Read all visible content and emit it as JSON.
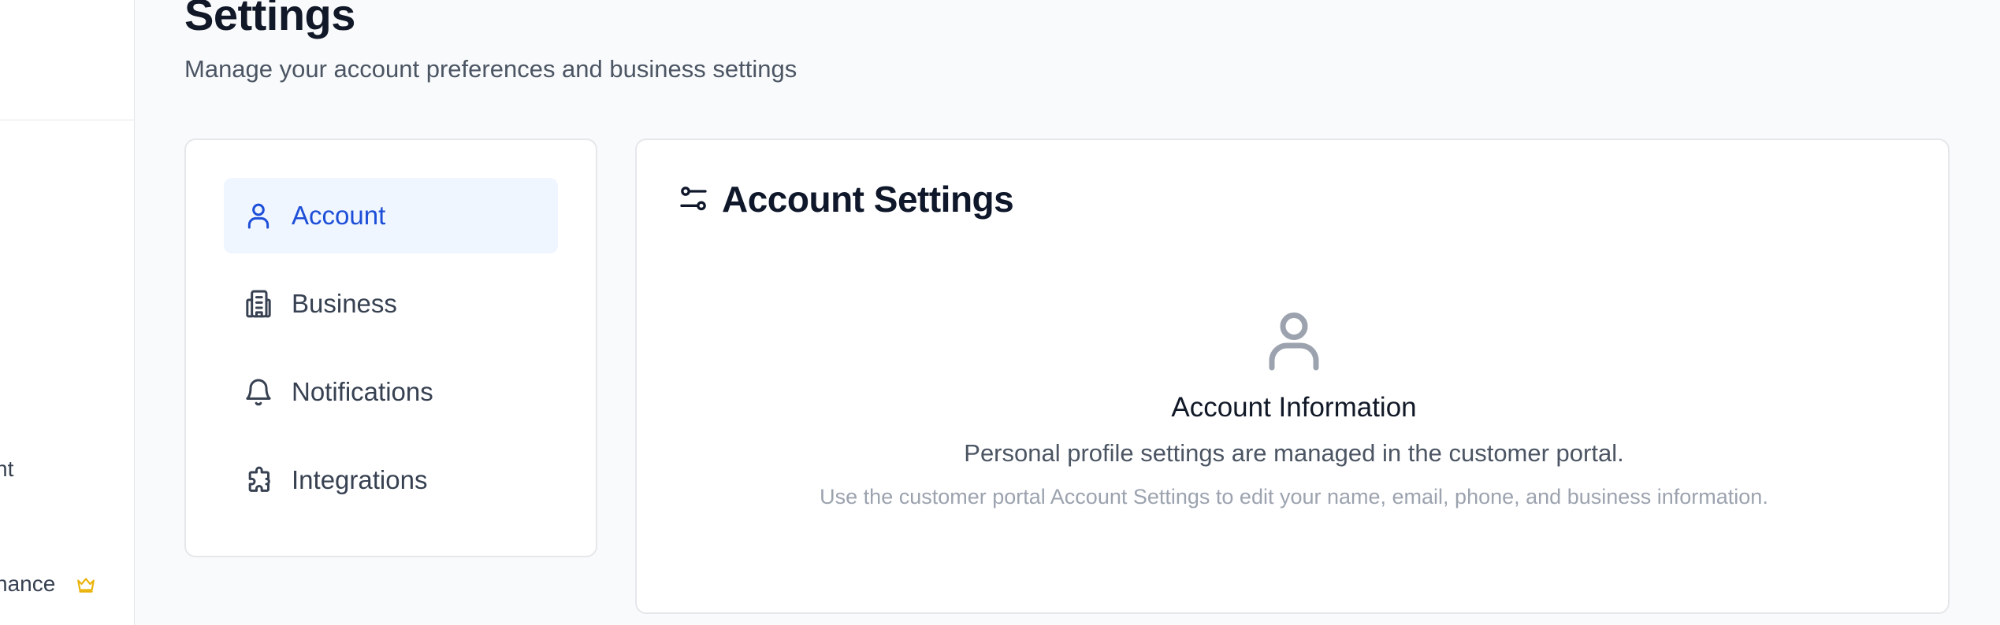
{
  "sidebar": {
    "items": [
      {
        "label": "nt"
      },
      {
        "label": "nance",
        "icon": "crown-icon"
      }
    ]
  },
  "page": {
    "title": "Settings",
    "subtitle": "Manage your account preferences and business settings"
  },
  "settings_nav": {
    "items": [
      {
        "label": "Account",
        "icon": "user-icon",
        "active": true
      },
      {
        "label": "Business",
        "icon": "building-icon"
      },
      {
        "label": "Notifications",
        "icon": "bell-icon"
      },
      {
        "label": "Integrations",
        "icon": "puzzle-icon"
      }
    ]
  },
  "main": {
    "title": "Account Settings",
    "icon": "sliders-icon",
    "empty_state": {
      "icon": "user-icon",
      "title": "Account Information",
      "description": "Personal profile settings are managed in the customer portal.",
      "hint": "Use the customer portal Account Settings to edit your name, email, phone, and business information."
    }
  },
  "colors": {
    "accent": "#1d4ed8",
    "active_bg": "#eff6ff",
    "crown": "#eab308",
    "muted": "#9ca3af"
  }
}
